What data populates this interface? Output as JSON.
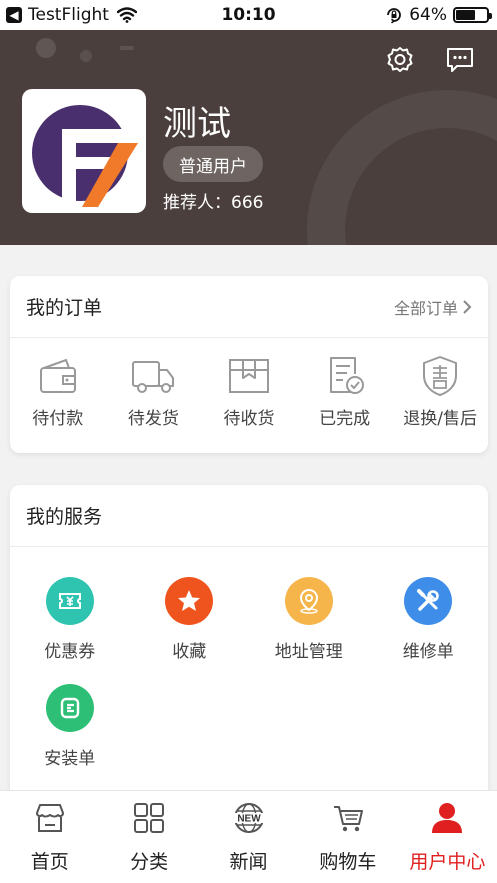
{
  "status_bar": {
    "app": "TestFlight",
    "time": "10:10",
    "battery": "64%",
    "battery_level": 0.64
  },
  "profile": {
    "name": "测试",
    "level": "普通用户",
    "referrer": "推荐人：666"
  },
  "orders": {
    "title": "我的订单",
    "all_label": "全部订单",
    "items": [
      {
        "label": "待付款",
        "icon": "wallet-icon"
      },
      {
        "label": "待发货",
        "icon": "truck-icon"
      },
      {
        "label": "待收货",
        "icon": "package-icon"
      },
      {
        "label": "已完成",
        "icon": "completed-document-icon"
      },
      {
        "label": "退换/售后",
        "icon": "after-sales-shield-icon"
      }
    ]
  },
  "services": {
    "title": "我的服务",
    "items": [
      {
        "label": "优惠券",
        "icon": "coupon-icon",
        "color": "#2ec4b0"
      },
      {
        "label": "收藏",
        "icon": "star-icon",
        "color": "#f0541e"
      },
      {
        "label": "地址管理",
        "icon": "location-icon",
        "color": "#f6b54a"
      },
      {
        "label": "维修单",
        "icon": "tools-icon",
        "color": "#3e8ee9"
      },
      {
        "label": "安装单",
        "icon": "install-icon",
        "color": "#2dbf75"
      }
    ]
  },
  "tabbar": {
    "active_color": "#e02020",
    "items": [
      {
        "label": "首页",
        "icon": "home-store-icon"
      },
      {
        "label": "分类",
        "icon": "grid-icon"
      },
      {
        "label": "新闻",
        "icon": "news-globe-icon",
        "icon_text": "NEW"
      },
      {
        "label": "购物车",
        "icon": "cart-icon"
      },
      {
        "label": "用户中心",
        "icon": "user-icon",
        "active": true
      }
    ]
  }
}
